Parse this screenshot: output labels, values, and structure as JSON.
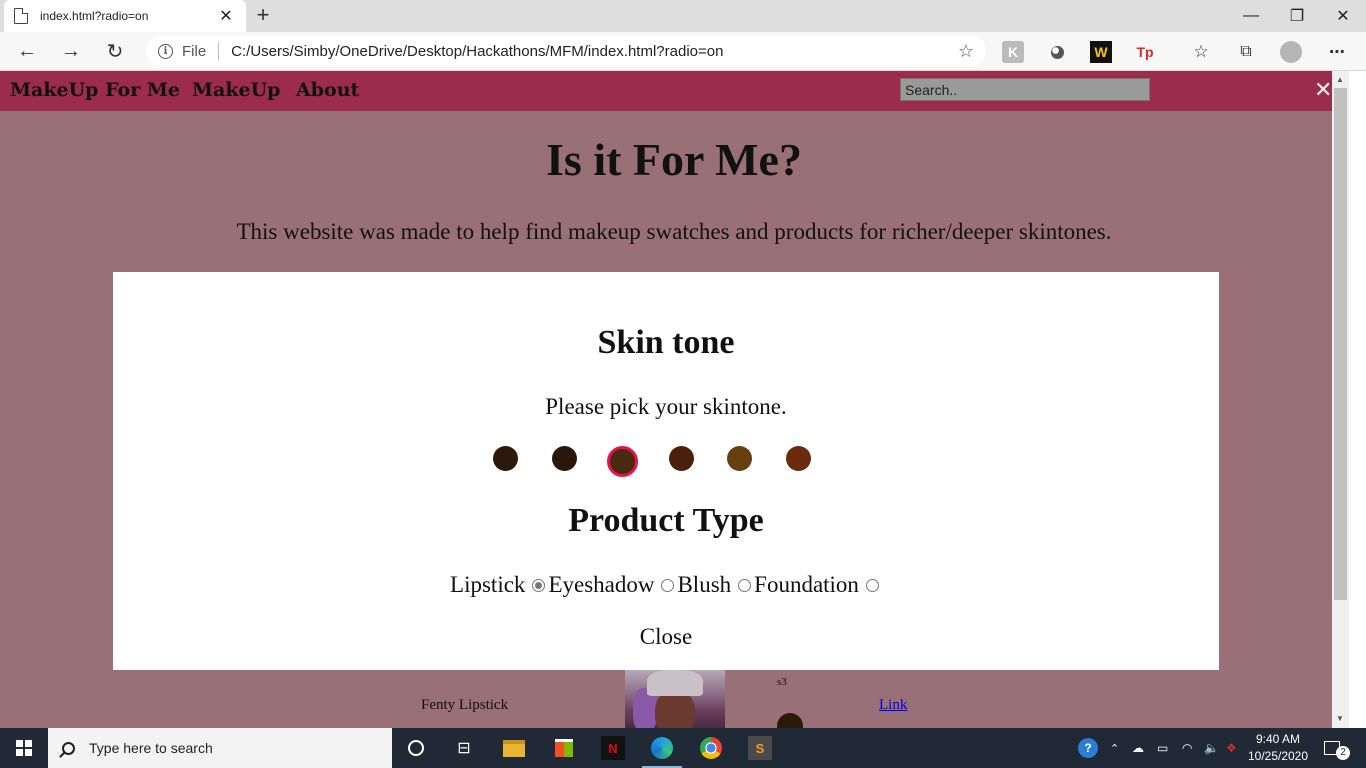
{
  "browser": {
    "tab_title": "index.html?radio=on",
    "tab_close": "✕",
    "new_tab": "+",
    "url_scheme_label": "File",
    "url": "C:/Users/Simby/OneDrive/Desktop/Hackathons/MFM/index.html?radio=on",
    "window_controls": {
      "minimize": "—",
      "restore": "❐",
      "close": "✕"
    },
    "nav": {
      "back": "←",
      "forward": "→",
      "reload": "↻"
    },
    "extensions": [
      "W",
      "Tp"
    ]
  },
  "site": {
    "nav_links": [
      "MakeUp For Me",
      "MakeUp",
      "About"
    ],
    "search_placeholder": "Search..",
    "close_glyph": "✕",
    "title": "Is it For Me?",
    "subtitle": "This website was made to help find makeup swatches and products for richer/deeper skintones."
  },
  "modal": {
    "skin_heading": "Skin tone",
    "skin_prompt": "Please pick your skintone.",
    "skin_swatches": [
      {
        "color": "#2b1a0a",
        "selected": false
      },
      {
        "color": "#2a160a",
        "selected": false
      },
      {
        "color": "#4a2a0e",
        "selected": true
      },
      {
        "color": "#4a1f0b",
        "selected": false
      },
      {
        "color": "#65400e",
        "selected": false
      },
      {
        "color": "#6a2a0b",
        "selected": false
      }
    ],
    "product_heading": "Product Type",
    "product_options": [
      {
        "label": "Lipstick",
        "checked": true
      },
      {
        "label": "Eyeshadow",
        "checked": false
      },
      {
        "label": "Blush",
        "checked": false
      },
      {
        "label": "Foundation",
        "checked": false
      }
    ],
    "close_label": "Close"
  },
  "product_list": {
    "name": "Fenty Lipstick",
    "shade_label": "s3",
    "swatch_color": "#2c1a08",
    "link_label": "Link"
  },
  "taskbar": {
    "search_placeholder": "Type here to search",
    "time": "9:40 AM",
    "date": "10/25/2020",
    "notifications": "2"
  },
  "colors": {
    "nav_bg": "#9b2c4e",
    "page_bg": "#9a7078",
    "selected_ring": "#e5134f"
  }
}
